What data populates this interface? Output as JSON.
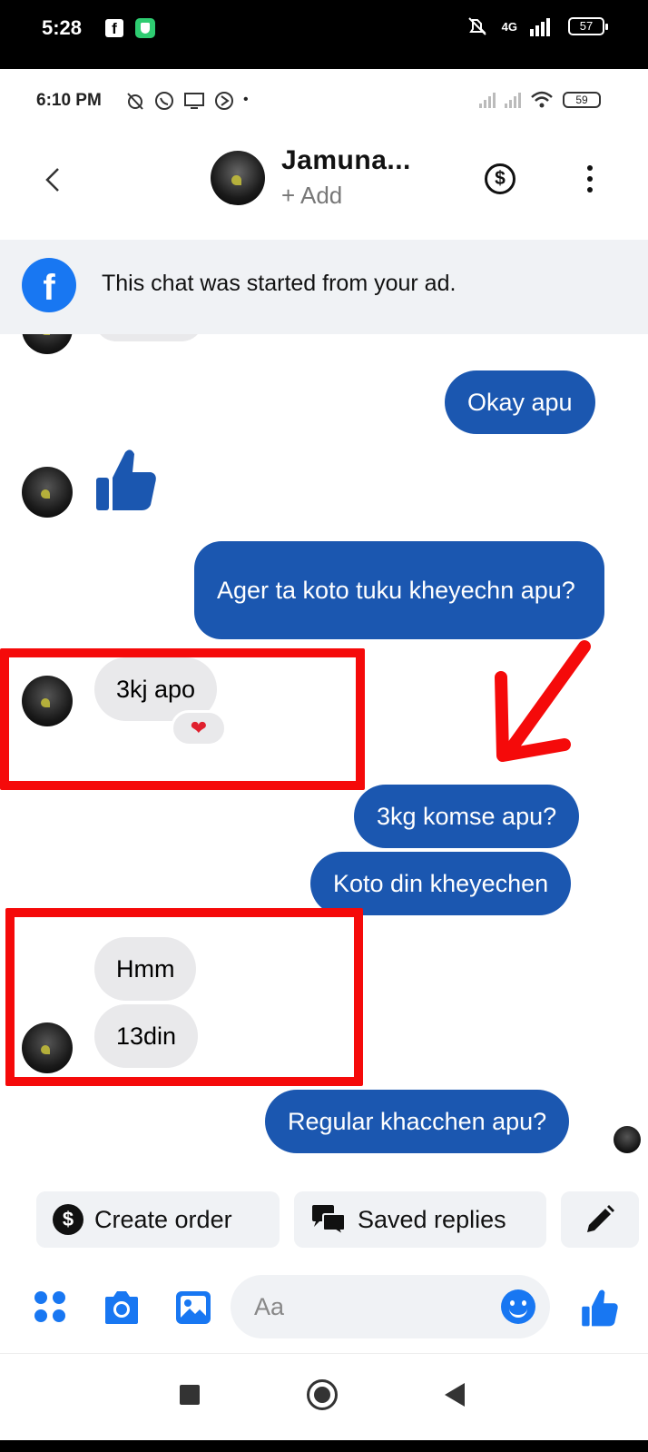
{
  "outer_status": {
    "time": "5:28",
    "fb_glyph": "f",
    "network": "4G",
    "battery": "57"
  },
  "inner_status": {
    "time": "6:10 PM",
    "battery": "59"
  },
  "header": {
    "name": "Jamuna...",
    "subtitle": "+ Add"
  },
  "banner": {
    "text": "This chat was started from your ad.",
    "fb_glyph": "f"
  },
  "messages": [
    {
      "dir": "out",
      "text": "Okay apu"
    },
    {
      "dir": "in",
      "type": "like"
    },
    {
      "dir": "out",
      "text": "Ager ta koto tuku kheyechn apu?"
    },
    {
      "dir": "in",
      "text": "3kj apo",
      "reaction": "❤"
    },
    {
      "dir": "out",
      "text": "3kg komse apu?"
    },
    {
      "dir": "out",
      "text": "Koto din kheyechen"
    },
    {
      "dir": "in",
      "text": "Hmm"
    },
    {
      "dir": "in",
      "text": "13din"
    },
    {
      "dir": "out",
      "text": "Regular khacchen apu?"
    }
  ],
  "quick_actions": {
    "create_order": "Create order",
    "saved_replies": "Saved replies",
    "dollar_glyph": "$"
  },
  "composer": {
    "placeholder": "Aa"
  },
  "colors": {
    "out_bubble": "#1b57b0",
    "in_bubble": "#e9e9eb",
    "accent": "#1877f2",
    "annotation": "#f50a0a"
  },
  "icons": [
    "back-icon",
    "dollar-icon",
    "more-icon",
    "facebook-icon",
    "thumbs-up-icon",
    "heart-icon",
    "pencil-icon",
    "apps-icon",
    "camera-icon",
    "gallery-icon",
    "emoji-icon",
    "like-icon"
  ]
}
